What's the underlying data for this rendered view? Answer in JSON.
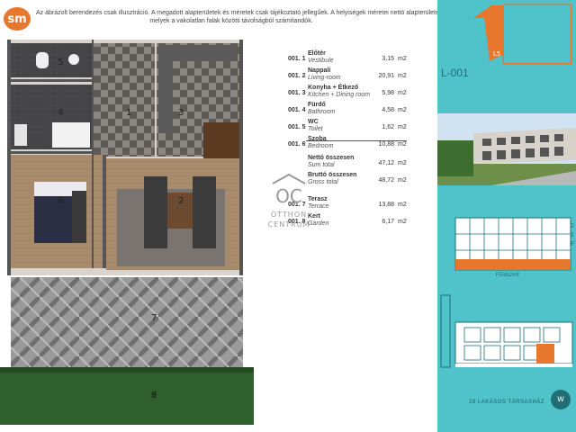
{
  "brand": {
    "logo_text": "sm"
  },
  "disclaimer": {
    "line1": "Az ábrázolt berendezés csak illusztráció. A megadott alapterületek és méretek csak tájékoztató jellegűek. A helyiségek méretei nettó alapterületek,",
    "line2": "melyek a vakolatlan falak közötti távolságból számítandók."
  },
  "plan_labels": [
    "1",
    "2",
    "3",
    "4",
    "5",
    "6",
    "7",
    "8"
  ],
  "rooms": [
    {
      "no": "001. 1",
      "name": "Előtér",
      "sub": "Vestibule",
      "area": "3,15",
      "unit": "m2"
    },
    {
      "no": "001. 2",
      "name": "Nappali",
      "sub": "Living-room",
      "area": "20,91",
      "unit": "m2"
    },
    {
      "no": "001. 3",
      "name": "Konyha + Étkező",
      "sub": "Kitchen + Dining room",
      "area": "5,98",
      "unit": "m2"
    },
    {
      "no": "001. 4",
      "name": "Fürdő",
      "sub": "Bathroom",
      "area": "4,58",
      "unit": "m2"
    },
    {
      "no": "001. 5",
      "name": "WC",
      "sub": "Toilet",
      "area": "1,62",
      "unit": "m2"
    },
    {
      "no": "001. 6",
      "name": "Szoba",
      "sub": "Bedroom",
      "area": "10,88",
      "unit": "m2"
    }
  ],
  "totals": [
    {
      "name": "Nettó összesen",
      "sub": "Sum total",
      "area": "47,12",
      "unit": "m2"
    },
    {
      "name": "Bruttó összesen",
      "sub": "Gross total",
      "area": "48,72",
      "unit": "m2"
    }
  ],
  "outdoor": [
    {
      "no": "001. 7",
      "name": "Terasz",
      "sub": "Terrace",
      "area": "13,88",
      "unit": "m2"
    },
    {
      "no": "001. 8",
      "name": "Kert",
      "sub": "Garden",
      "area": "6,17",
      "unit": "m2"
    }
  ],
  "agency": {
    "mark": "OC",
    "line1": "OTTHON",
    "line2": "CENTRUM"
  },
  "sidebar": {
    "unit_code": "L-001",
    "marker": "L5",
    "floor_numbers": [
      "2",
      "1",
      "F"
    ],
    "elevation_label": "Földszint",
    "project_name": "28 LAKÁSOS TÁRSASHÁZ",
    "footer_logo": "w"
  },
  "colors": {
    "accent": "#e8772e",
    "sidebar": "#4fc3c9",
    "sidebar_dark": "#1d6f75"
  }
}
